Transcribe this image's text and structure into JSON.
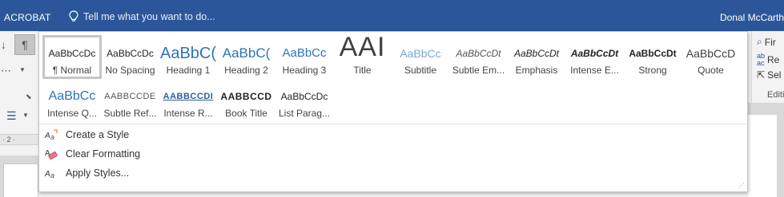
{
  "titlebar": {
    "tab_label": "ACROBAT",
    "tell_me": "Tell me what you want to do...",
    "user": "Donal McCarth"
  },
  "ruler": {
    "marker": "· 2 ·"
  },
  "editing": {
    "find": "Fir",
    "replace": "Re",
    "select": "Sel",
    "group_label": "Editi"
  },
  "styles": [
    {
      "name": "¶ Normal",
      "sample": "AaBbCcDc",
      "selected": true
    },
    {
      "name": "No Spacing",
      "sample": "AaBbCcDc"
    },
    {
      "name": "Heading 1",
      "sample": "AaBbC("
    },
    {
      "name": "Heading 2",
      "sample": "AaBbC("
    },
    {
      "name": "Heading 3",
      "sample": "AaBbCc"
    },
    {
      "name": "Title",
      "sample": "AAI"
    },
    {
      "name": "Subtitle",
      "sample": "AaBbCc"
    },
    {
      "name": "Subtle Em...",
      "sample": "AaBbCcDt"
    },
    {
      "name": "Emphasis",
      "sample": "AaBbCcDt"
    },
    {
      "name": "Intense E...",
      "sample": "AaBbCcDt"
    },
    {
      "name": "Strong",
      "sample": "AaBbCcDt"
    },
    {
      "name": "Quote",
      "sample": "AaBbCcD"
    },
    {
      "name": "Intense Q...",
      "sample": "AaBbCc"
    },
    {
      "name": "Subtle Ref...",
      "sample": "AABBCCDE"
    },
    {
      "name": "Intense R...",
      "sample": "AABBCCDI"
    },
    {
      "name": "Book Title",
      "sample": "AABBCCD"
    },
    {
      "name": "List Parag...",
      "sample": "AaBbCcDc"
    }
  ],
  "menu": {
    "create": "Create a Style",
    "clear": "Clear Formatting",
    "apply": "Apply Styles..."
  },
  "colors": {
    "titlebar": "#2b579a",
    "heading_blue": "#2e74b5",
    "title_dark": "#404040"
  }
}
